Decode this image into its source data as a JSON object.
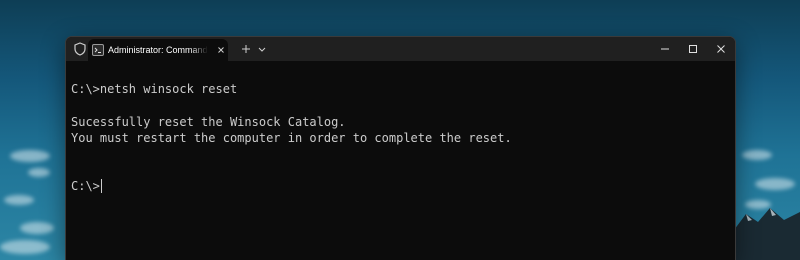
{
  "window": {
    "tab_title": "Administrator: Command Pro",
    "tab_icon": "terminal-icon",
    "titlebar_icon": "shield-icon"
  },
  "titlebar": {
    "new_tab_icon": "plus-icon",
    "dropdown_icon": "chevron-down-icon",
    "controls": [
      "minimize-icon",
      "maximize-icon",
      "close-icon"
    ]
  },
  "terminal": {
    "command_line": "C:\\>netsh winsock reset",
    "output_line_1": "Sucessfully reset the Winsock Catalog.",
    "output_line_2": "You must restart the computer in order to complete the reset.",
    "prompt": "C:\\>"
  },
  "colors": {
    "terminal_bg": "#0c0c0c",
    "terminal_text": "#cccccc",
    "titlebar_bg": "#202020"
  }
}
